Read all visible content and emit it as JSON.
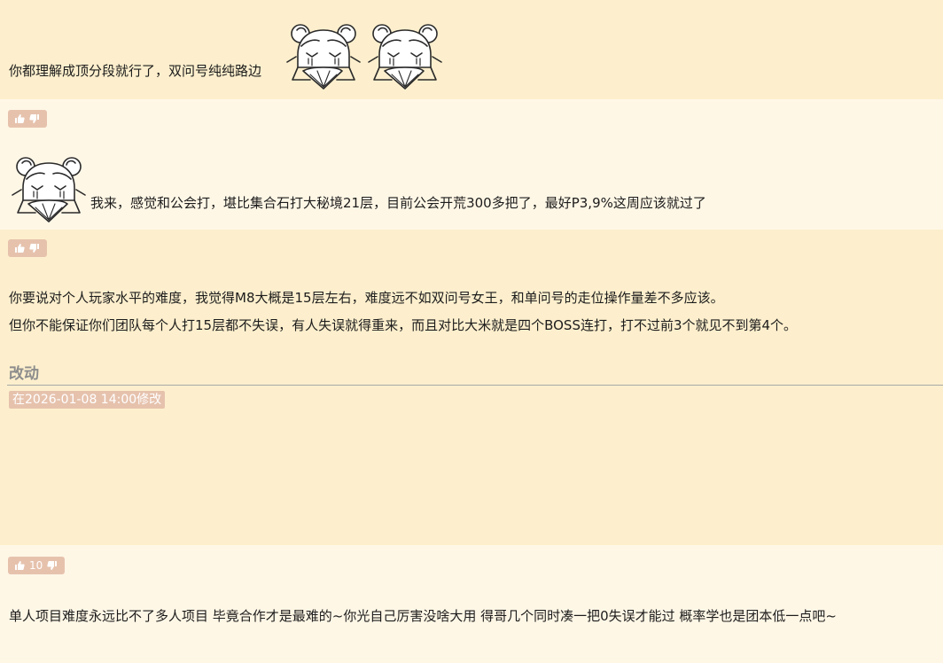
{
  "posts": [
    {
      "text": "你都理解成顶分段就行了，双问号纯纯路边",
      "stickers": [
        "laughing-fan-girl-sticker",
        "laughing-fan-girl-sticker"
      ],
      "vote_count": ""
    },
    {
      "text": "我来，感觉和公会打，堪比集合石打大秘境21层，目前公会开荒300多把了，最好P3,9%这周应该就过了",
      "stickers": [
        "laughing-fan-girl-sticker"
      ],
      "vote_count": ""
    },
    {
      "lines": [
        "你要说对个人玩家水平的难度，我觉得M8大概是15层左右，难度远不如双问号女王，和单问号的走位操作量差不多应该。",
        "但你不能保证你们团队每个人打15层都不失误，有人失误就得重来，而且对比大米就是四个BOSS连打，打不过前3个就见不到第4个。"
      ],
      "edit": {
        "heading": "改动",
        "timestamp": "在2026-01-08 14:00修改"
      },
      "vote_count": ""
    },
    {
      "text": "单人项目难度永远比不了多人项目 毕竟合作才是最难的~你光自己厉害没啥大用 得哥几个同时凑一把0失误才能过 概率学也是团本低一点吧~",
      "vote_count": "10"
    }
  ],
  "icons": {
    "upvote": "thumbs-up-icon",
    "downvote": "thumbs-down-icon"
  },
  "colors": {
    "post_bg_a": "#fdefcd",
    "post_bg_b": "#fff7e6",
    "vote_bg": "#e6c2ad",
    "muted_heading": "#8c8c8c"
  }
}
